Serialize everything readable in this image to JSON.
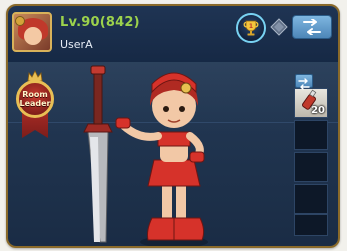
{
  "profile": {
    "level": "Lv.90",
    "level_extra": "(842)",
    "username": "UserA"
  },
  "header_buttons": {
    "trophy_icon": "trophy-icon",
    "diamond_icon": "diamond-icon",
    "swap_icon": "swap-arrows-icon"
  },
  "room_leader": {
    "line1": "Room",
    "line2": "Leader"
  },
  "inventory": {
    "item_count": "20"
  },
  "colors": {
    "level_green": "#9cd24c",
    "trophy_ring": "#78d2f2",
    "banner_red": "#b8312a",
    "gold": "#e8bf55"
  }
}
